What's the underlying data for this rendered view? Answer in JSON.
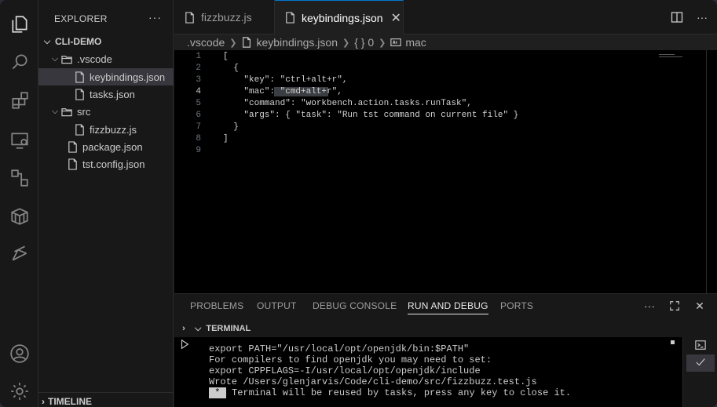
{
  "sidebar": {
    "title": "EXPLORER",
    "more": "···",
    "root": "CLI-DEMO",
    "items": [
      {
        "label": ".vscode",
        "icon": "folder-open-icon"
      },
      {
        "label": "keybindings.json",
        "icon": "file-icon"
      },
      {
        "label": "tasks.json",
        "icon": "file-icon"
      },
      {
        "label": "src",
        "icon": "folder-open-icon"
      },
      {
        "label": "fizzbuzz.js",
        "icon": "file-icon"
      },
      {
        "label": "package.json",
        "icon": "file-icon"
      },
      {
        "label": "tst.config.json",
        "icon": "file-icon"
      }
    ],
    "timeline": "TIMELINE"
  },
  "tabs": [
    {
      "label": "fizzbuzz.js"
    },
    {
      "label": "keybindings.json",
      "close": "✕"
    }
  ],
  "breadcrumbs": [
    ".vscode",
    "keybindings.json",
    "{ } 0",
    "mac"
  ],
  "editor": {
    "lines": [
      {
        "n": "1",
        "text": "["
      },
      {
        "n": "2",
        "text": "  {"
      },
      {
        "n": "3",
        "text": "    \"key\": \"ctrl+alt+r\","
      },
      {
        "n": "4",
        "text": "    \"mac\": \"cmd+alt+r\","
      },
      {
        "n": "5",
        "text": "    \"command\": \"workbench.action.tasks.runTask\","
      },
      {
        "n": "6",
        "text": "    \"args\": { \"task\": \"Run tst command on current file\" }"
      },
      {
        "n": "7",
        "text": "  }"
      },
      {
        "n": "8",
        "text": "]"
      },
      {
        "n": "9",
        "text": ""
      }
    ]
  },
  "panel": {
    "tabs": [
      "PROBLEMS",
      "OUTPUT",
      "DEBUG CONSOLE",
      "RUN AND DEBUG",
      "PORTS"
    ],
    "active_tab": "RUN AND DEBUG",
    "more": "···",
    "terminal_label": "TERMINAL",
    "terminal_lines": [
      "export PATH=\"/usr/local/opt/openjdk/bin:$PATH\"",
      "For compilers to find openjdk you may need to set:",
      "export CPPFLAGS=-I/usr/local/opt/openjdk/include",
      "Wrote /Users/glenjarvis/Code/cli-demo/src/fizzbuzz.test.js",
      " * ",
      "Terminal will be reused by tasks, press any key to close it."
    ]
  },
  "colors": {
    "editor_bg": "#000000",
    "sidebar_bg": "#181818",
    "accent": "#0078d4",
    "string": "#ce9178",
    "key": "#9cdcfe"
  }
}
